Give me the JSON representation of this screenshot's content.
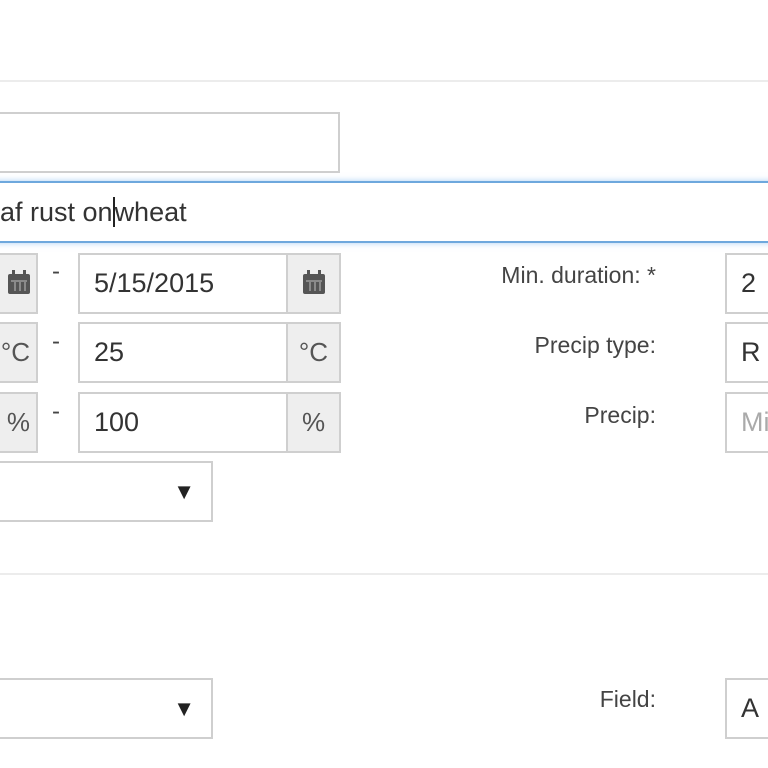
{
  "form": {
    "name_value": "",
    "description_value": "af rust on wheat",
    "description_before_cursor": "af rust on",
    "description_after_cursor": "wheat",
    "date_start_value": "",
    "date_end_value": "5/15/2015",
    "temp_start_value": "",
    "temp_end_value": "25",
    "temp_unit": "°C",
    "temp_unit_cut": "°C",
    "humidity_start_value": "",
    "humidity_end_value": "100",
    "humidity_unit": "%",
    "range_separator": "-",
    "min_duration_label": "Min. duration: *",
    "min_duration_value": "2",
    "precip_type_label": "Precip type:",
    "precip_type_value": "R",
    "precip_label": "Precip:",
    "precip_placeholder": "Mi",
    "field_label": "Field:",
    "field_value": "A"
  },
  "icons": {
    "calendar": "calendar-icon",
    "dropdown": "chevron-down-icon",
    "dropdown_glyph": "▼"
  }
}
